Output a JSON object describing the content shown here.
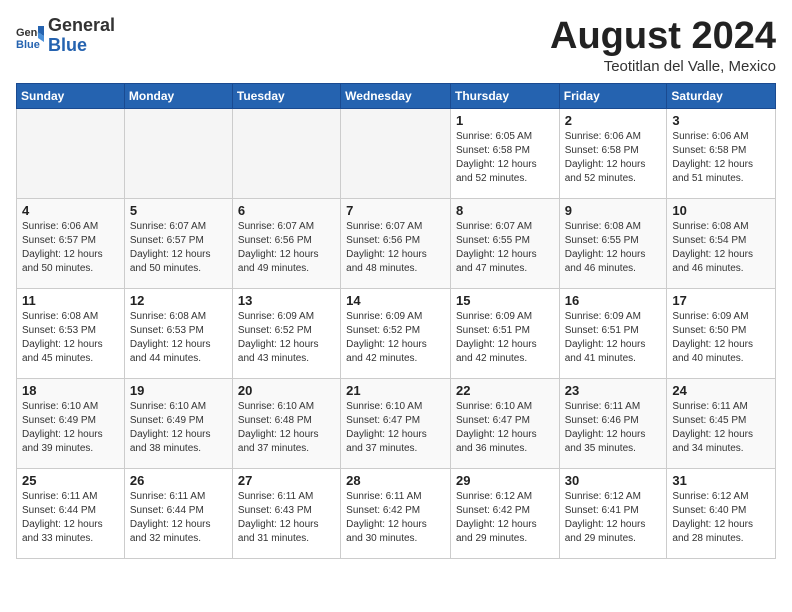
{
  "header": {
    "logo_general": "General",
    "logo_blue": "Blue",
    "title": "August 2024",
    "subtitle": "Teotitlan del Valle, Mexico"
  },
  "weekdays": [
    "Sunday",
    "Monday",
    "Tuesday",
    "Wednesday",
    "Thursday",
    "Friday",
    "Saturday"
  ],
  "weeks": [
    [
      {
        "day": "",
        "info": ""
      },
      {
        "day": "",
        "info": ""
      },
      {
        "day": "",
        "info": ""
      },
      {
        "day": "",
        "info": ""
      },
      {
        "day": "1",
        "info": "Sunrise: 6:05 AM\nSunset: 6:58 PM\nDaylight: 12 hours\nand 52 minutes."
      },
      {
        "day": "2",
        "info": "Sunrise: 6:06 AM\nSunset: 6:58 PM\nDaylight: 12 hours\nand 52 minutes."
      },
      {
        "day": "3",
        "info": "Sunrise: 6:06 AM\nSunset: 6:58 PM\nDaylight: 12 hours\nand 51 minutes."
      }
    ],
    [
      {
        "day": "4",
        "info": "Sunrise: 6:06 AM\nSunset: 6:57 PM\nDaylight: 12 hours\nand 50 minutes."
      },
      {
        "day": "5",
        "info": "Sunrise: 6:07 AM\nSunset: 6:57 PM\nDaylight: 12 hours\nand 50 minutes."
      },
      {
        "day": "6",
        "info": "Sunrise: 6:07 AM\nSunset: 6:56 PM\nDaylight: 12 hours\nand 49 minutes."
      },
      {
        "day": "7",
        "info": "Sunrise: 6:07 AM\nSunset: 6:56 PM\nDaylight: 12 hours\nand 48 minutes."
      },
      {
        "day": "8",
        "info": "Sunrise: 6:07 AM\nSunset: 6:55 PM\nDaylight: 12 hours\nand 47 minutes."
      },
      {
        "day": "9",
        "info": "Sunrise: 6:08 AM\nSunset: 6:55 PM\nDaylight: 12 hours\nand 46 minutes."
      },
      {
        "day": "10",
        "info": "Sunrise: 6:08 AM\nSunset: 6:54 PM\nDaylight: 12 hours\nand 46 minutes."
      }
    ],
    [
      {
        "day": "11",
        "info": "Sunrise: 6:08 AM\nSunset: 6:53 PM\nDaylight: 12 hours\nand 45 minutes."
      },
      {
        "day": "12",
        "info": "Sunrise: 6:08 AM\nSunset: 6:53 PM\nDaylight: 12 hours\nand 44 minutes."
      },
      {
        "day": "13",
        "info": "Sunrise: 6:09 AM\nSunset: 6:52 PM\nDaylight: 12 hours\nand 43 minutes."
      },
      {
        "day": "14",
        "info": "Sunrise: 6:09 AM\nSunset: 6:52 PM\nDaylight: 12 hours\nand 42 minutes."
      },
      {
        "day": "15",
        "info": "Sunrise: 6:09 AM\nSunset: 6:51 PM\nDaylight: 12 hours\nand 42 minutes."
      },
      {
        "day": "16",
        "info": "Sunrise: 6:09 AM\nSunset: 6:51 PM\nDaylight: 12 hours\nand 41 minutes."
      },
      {
        "day": "17",
        "info": "Sunrise: 6:09 AM\nSunset: 6:50 PM\nDaylight: 12 hours\nand 40 minutes."
      }
    ],
    [
      {
        "day": "18",
        "info": "Sunrise: 6:10 AM\nSunset: 6:49 PM\nDaylight: 12 hours\nand 39 minutes."
      },
      {
        "day": "19",
        "info": "Sunrise: 6:10 AM\nSunset: 6:49 PM\nDaylight: 12 hours\nand 38 minutes."
      },
      {
        "day": "20",
        "info": "Sunrise: 6:10 AM\nSunset: 6:48 PM\nDaylight: 12 hours\nand 37 minutes."
      },
      {
        "day": "21",
        "info": "Sunrise: 6:10 AM\nSunset: 6:47 PM\nDaylight: 12 hours\nand 37 minutes."
      },
      {
        "day": "22",
        "info": "Sunrise: 6:10 AM\nSunset: 6:47 PM\nDaylight: 12 hours\nand 36 minutes."
      },
      {
        "day": "23",
        "info": "Sunrise: 6:11 AM\nSunset: 6:46 PM\nDaylight: 12 hours\nand 35 minutes."
      },
      {
        "day": "24",
        "info": "Sunrise: 6:11 AM\nSunset: 6:45 PM\nDaylight: 12 hours\nand 34 minutes."
      }
    ],
    [
      {
        "day": "25",
        "info": "Sunrise: 6:11 AM\nSunset: 6:44 PM\nDaylight: 12 hours\nand 33 minutes."
      },
      {
        "day": "26",
        "info": "Sunrise: 6:11 AM\nSunset: 6:44 PM\nDaylight: 12 hours\nand 32 minutes."
      },
      {
        "day": "27",
        "info": "Sunrise: 6:11 AM\nSunset: 6:43 PM\nDaylight: 12 hours\nand 31 minutes."
      },
      {
        "day": "28",
        "info": "Sunrise: 6:11 AM\nSunset: 6:42 PM\nDaylight: 12 hours\nand 30 minutes."
      },
      {
        "day": "29",
        "info": "Sunrise: 6:12 AM\nSunset: 6:42 PM\nDaylight: 12 hours\nand 29 minutes."
      },
      {
        "day": "30",
        "info": "Sunrise: 6:12 AM\nSunset: 6:41 PM\nDaylight: 12 hours\nand 29 minutes."
      },
      {
        "day": "31",
        "info": "Sunrise: 6:12 AM\nSunset: 6:40 PM\nDaylight: 12 hours\nand 28 minutes."
      }
    ]
  ]
}
